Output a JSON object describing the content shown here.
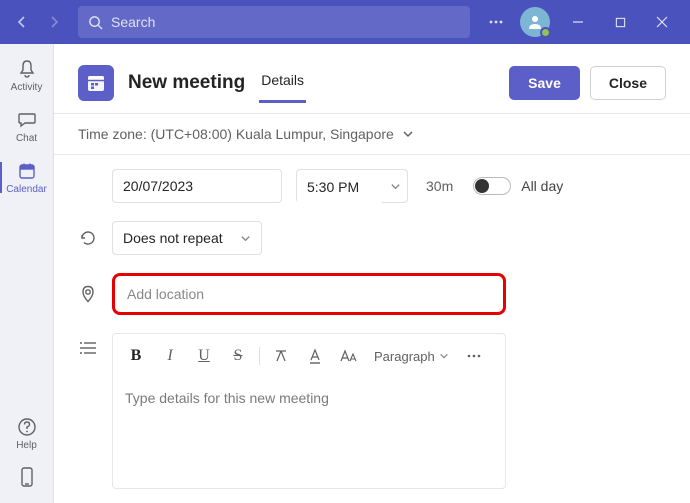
{
  "titlebar": {
    "search_placeholder": "Search"
  },
  "sidebar": {
    "items": [
      {
        "label": "Activity"
      },
      {
        "label": "Chat"
      },
      {
        "label": "Calendar"
      },
      {
        "label": "Help"
      }
    ]
  },
  "header": {
    "title": "New meeting",
    "tab_label": "Details",
    "save_label": "Save",
    "close_label": "Close"
  },
  "timezone": {
    "text": "Time zone: (UTC+08:00) Kuala Lumpur, Singapore"
  },
  "form": {
    "date": "20/07/2023",
    "time": "5:30 PM",
    "duration": "30m",
    "allday_label": "All day",
    "repeat": "Does not repeat",
    "location_placeholder": "Add location",
    "editor": {
      "paragraph_label": "Paragraph",
      "placeholder": "Type details for this new meeting"
    }
  }
}
